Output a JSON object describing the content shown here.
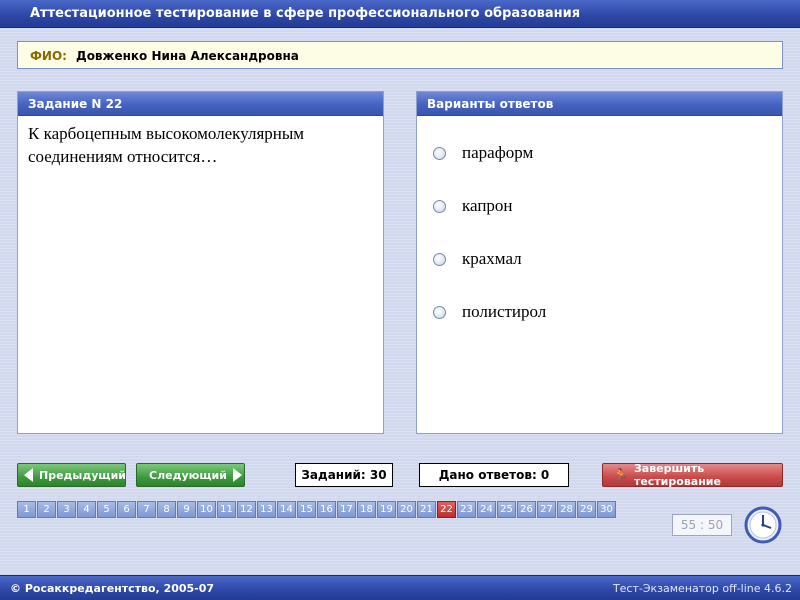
{
  "window": {
    "title": "Аттестационное тестирование в сфере профессионального образования"
  },
  "fio": {
    "label": "ФИО:",
    "value": "Довженко Нина Александровна"
  },
  "question": {
    "header": "Задание N 22",
    "text_line1": "К карбоцепным высокомолекулярным",
    "text_line2": "соединениям относится…"
  },
  "answers": {
    "header": "Варианты ответов",
    "options": [
      "параформ",
      "капрон",
      "крахмал",
      "полистирол"
    ]
  },
  "controls": {
    "prev_label": "Предыдущий",
    "next_label": "Следующий",
    "total_label": "Заданий: 30",
    "answered_label": "Дано ответов: 0",
    "finish_label": "Завершить тестирование"
  },
  "navigation": {
    "current": 22,
    "numbers": [
      "1",
      "2",
      "3",
      "4",
      "5",
      "6",
      "7",
      "8",
      "9",
      "10",
      "11",
      "12",
      "13",
      "14",
      "15",
      "16",
      "17",
      "18",
      "19",
      "20",
      "21",
      "22",
      "23",
      "24",
      "25",
      "26",
      "27",
      "28",
      "29",
      "30"
    ]
  },
  "timer": {
    "value": "55 : 50"
  },
  "footer": {
    "left": "© Росаккредагентство, 2005-07",
    "right": "Тест-Экзаменатор off-line 4.6.2"
  },
  "colors": {
    "header_blue": "#2d47a6",
    "nav_current": "#b83030",
    "green_button": "#3f9a3f",
    "finish_button": "#c94a4a"
  }
}
